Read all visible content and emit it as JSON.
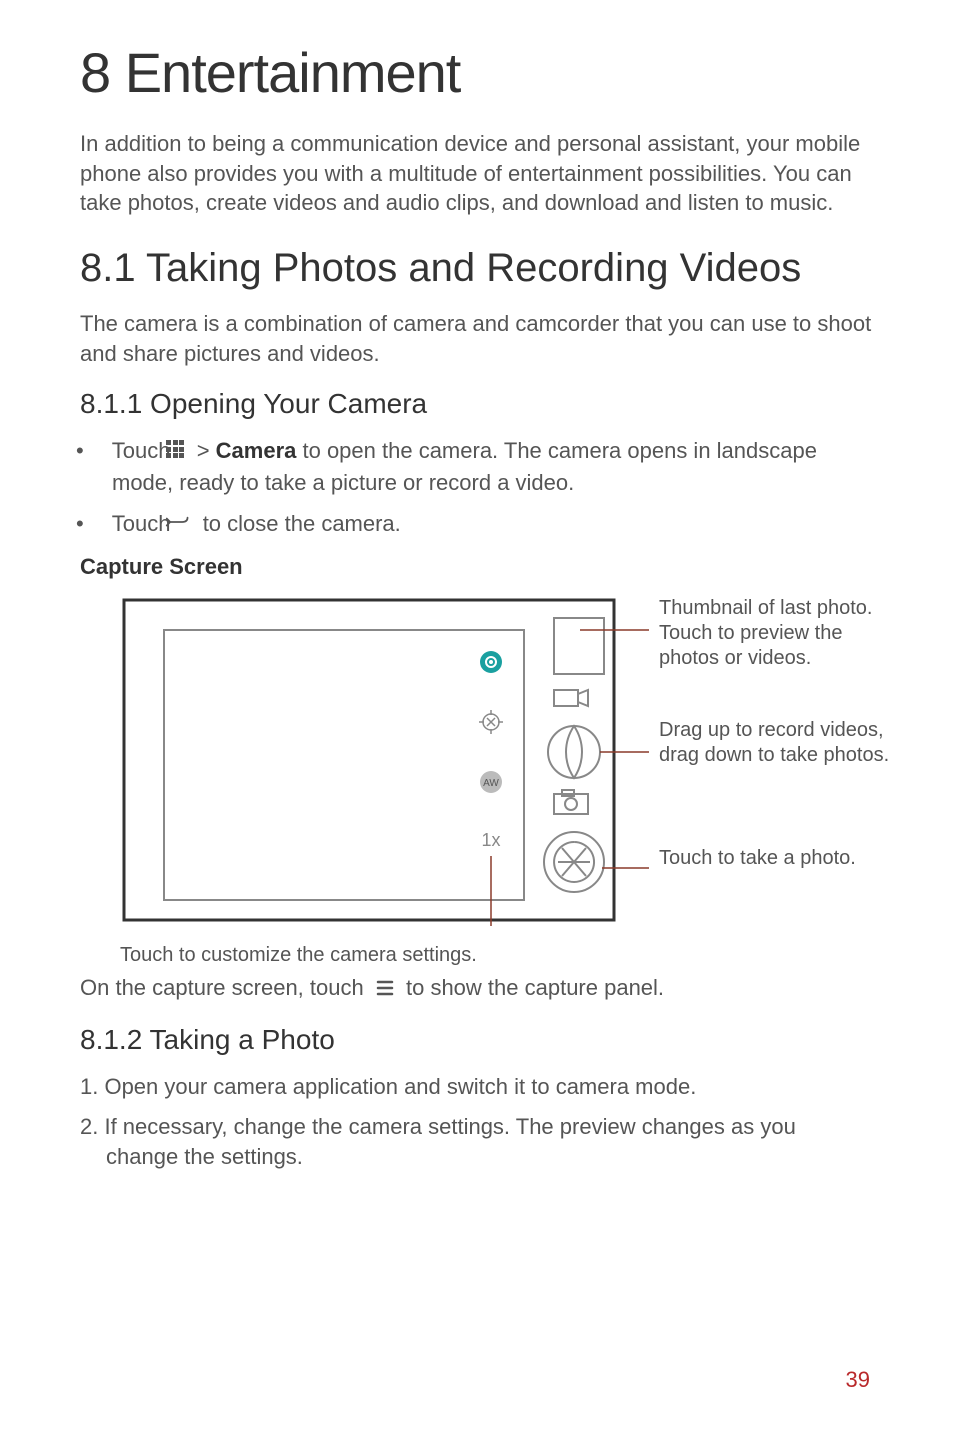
{
  "h1": "8  Entertainment",
  "intro": "In addition to being a communication device and personal assistant, your mobile phone also provides you with a multitude of entertainment possibilities. You can take photos, create videos and audio clips, and download and listen to music.",
  "h2": "8.1  Taking Photos and Recording Videos",
  "p81": "The camera is a combination of camera and camcorder that you can use to shoot and share pictures and videos.",
  "h3a": "8.1.1  Opening Your Camera",
  "bullet1_pre": "Touch",
  "bullet1_mid": " > ",
  "bullet1_bold": "Camera",
  "bullet1_post": " to open the camera. The camera opens in landscape mode, ready to take a picture or record a video.",
  "bullet2_pre": "Touch",
  "bullet2_post": " to close the camera.",
  "subhead_capture": "Capture Screen",
  "diagram": {
    "callout_thumb": "Thumbnail of last photo. Touch to preview the photos or videos.",
    "callout_drag": "Drag up to record videos, drag down to take photos.",
    "callout_shutter": "Touch to take a photo.",
    "callout_settings": "Touch to customize the camera settings.",
    "zoom_label": "1x",
    "aw_label": "AW"
  },
  "panel_sentence_pre": "On the capture screen, touch",
  "panel_sentence_post": " to show the capture panel.",
  "h3b": "8.1.2  Taking a Photo",
  "steps": [
    "1. Open your camera application and switch it to camera mode.",
    "2. If necessary, change the camera settings. The preview changes as you change the settings."
  ],
  "page_number": "39"
}
